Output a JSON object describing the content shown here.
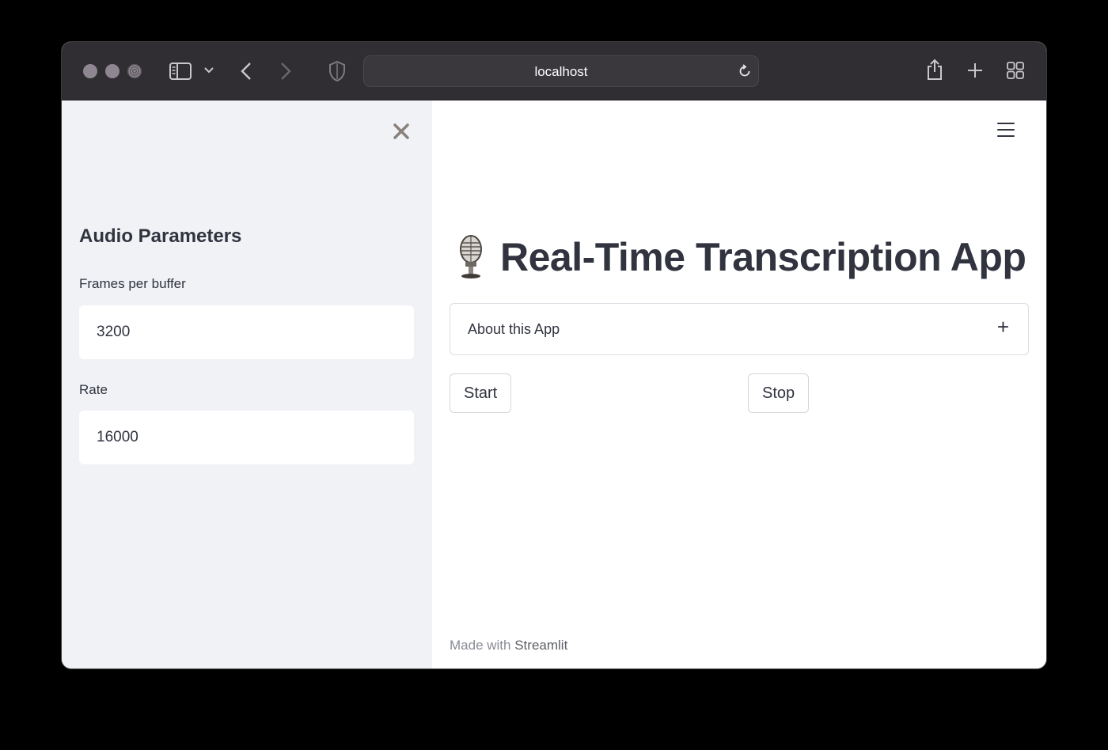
{
  "browser": {
    "url": "localhost",
    "icons": [
      "sidebar-toggle-icon",
      "chevron-down-icon",
      "back-icon",
      "forward-icon",
      "privacy-shield-icon",
      "reload-icon",
      "share-icon",
      "new-tab-icon",
      "tab-overview-icon"
    ]
  },
  "sidebar": {
    "heading": "Audio Parameters",
    "fields": [
      {
        "label": "Frames per buffer",
        "value": "3200"
      },
      {
        "label": "Rate",
        "value": "16000"
      }
    ]
  },
  "main": {
    "title": "Real-Time Transcription App",
    "title_icon": "microphone-icon",
    "expander": {
      "label": "About this App",
      "icon": "+"
    },
    "buttons": {
      "start": "Start",
      "stop": "Stop"
    },
    "footer": {
      "made_with": "Made with",
      "link": "Streamlit"
    }
  }
}
